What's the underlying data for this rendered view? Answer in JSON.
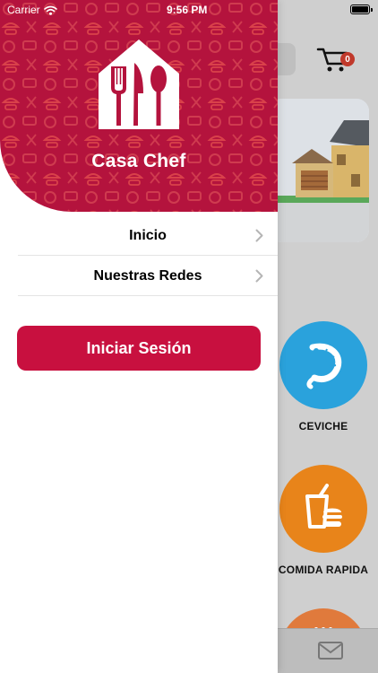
{
  "status_bar": {
    "carrier": "Carrier",
    "time": "9:56 PM"
  },
  "drawer": {
    "brand_name": "Casa Chef",
    "menu": [
      {
        "label": "Inicio"
      },
      {
        "label": "Nuestras Redes"
      }
    ],
    "login_label": "Iniciar Sesión"
  },
  "background": {
    "cart_count": "0",
    "categories": [
      {
        "label": "CEVICHE",
        "color": "#2aa2dc"
      },
      {
        "label": "COMIDA RAPIDA",
        "color": "#e8841a"
      },
      {
        "label": "",
        "color": "#e07a3c"
      }
    ]
  },
  "colors": {
    "brand": "#b4133d",
    "button": "#c8103f"
  }
}
